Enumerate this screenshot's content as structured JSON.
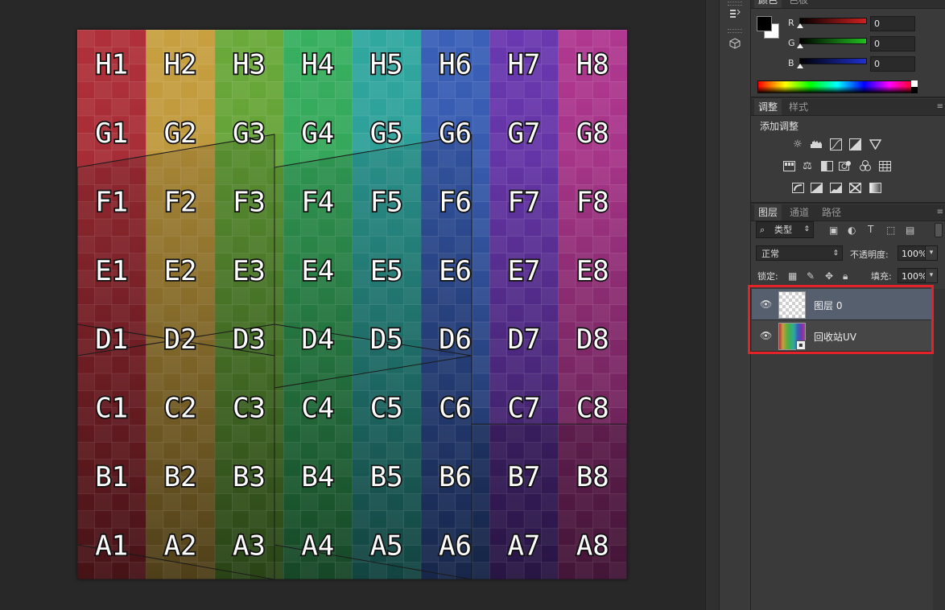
{
  "canvas": {
    "columns": [
      "1",
      "2",
      "3",
      "4",
      "5",
      "6",
      "7",
      "8"
    ],
    "rows": [
      "H",
      "G",
      "F",
      "E",
      "D",
      "C",
      "B",
      "A"
    ],
    "column_colors": [
      "#b0303a",
      "#c8a040",
      "#6aaa3a",
      "#38b060",
      "#30a8a0",
      "#3a60b8",
      "#6a38b0",
      "#b03890"
    ]
  },
  "color_panel": {
    "tabs": [
      "颜色",
      "色板"
    ],
    "channels": [
      {
        "label": "R",
        "value": "0",
        "color": "#d02020"
      },
      {
        "label": "G",
        "value": "0",
        "color": "#20b020"
      },
      {
        "label": "B",
        "value": "0",
        "color": "#2030c0"
      }
    ]
  },
  "adjustments_panel": {
    "tabs": [
      "调整",
      "样式"
    ],
    "title": "添加调整",
    "rows": [
      [
        "brightness-contrast-icon",
        "levels-icon",
        "curves-icon",
        "exposure-icon",
        "vibrance-icon"
      ],
      [
        "hue-saturation-icon",
        "color-balance-icon",
        "black-white-icon",
        "photo-filter-icon",
        "channel-mixer-icon",
        "color-lookup-icon"
      ],
      [
        "invert-icon",
        "posterize-icon",
        "threshold-icon",
        "selective-color-icon",
        "gradient-map-icon"
      ]
    ]
  },
  "layers_panel": {
    "tabs": [
      "图层",
      "通道",
      "路径"
    ],
    "filter_label": "类型",
    "blend_mode": "正常",
    "opacity_label": "不透明度:",
    "opacity_value": "100%",
    "lock_label": "锁定:",
    "fill_label": "填充:",
    "fill_value": "100%",
    "layers": [
      {
        "name": "图层 0",
        "selected": true
      },
      {
        "name": "回收站UV",
        "selected": false
      }
    ]
  }
}
